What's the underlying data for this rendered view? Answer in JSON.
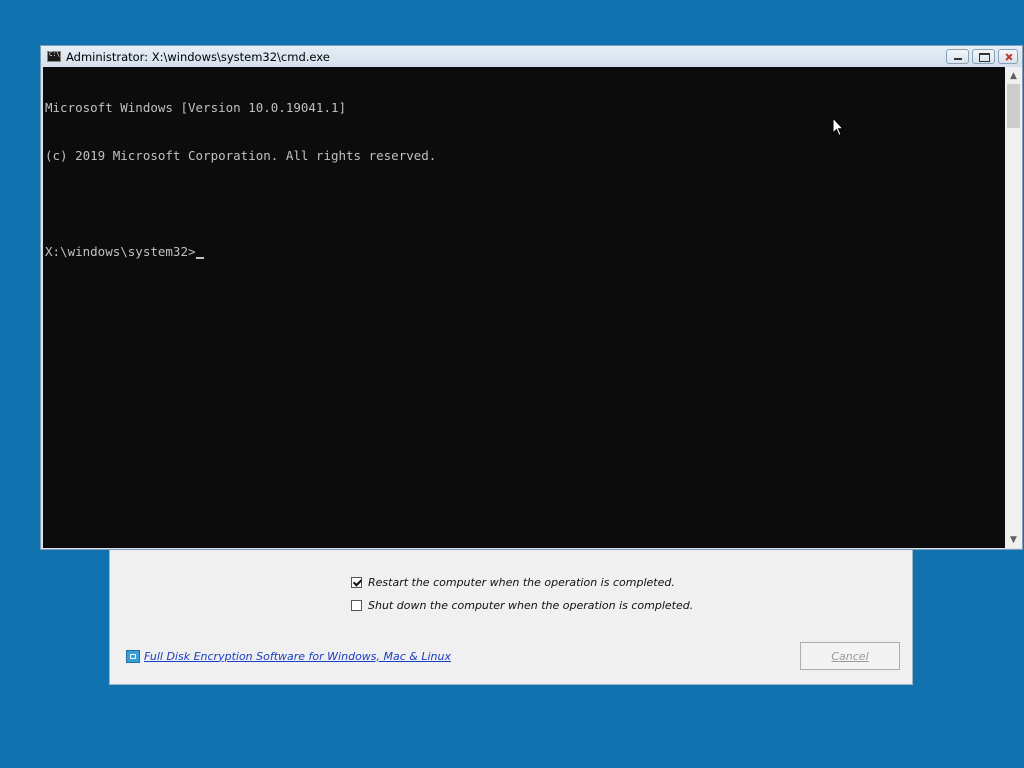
{
  "dialog": {
    "options": [
      {
        "label": "Restart the computer when the operation is completed.",
        "checked": true
      },
      {
        "label": "Shut down the computer when the operation is completed.",
        "checked": false
      }
    ],
    "link_text": "Full Disk Encryption Software for Windows, Mac & Linux",
    "cancel_label": "Cancel"
  },
  "cmd": {
    "title": "Administrator: X:\\windows\\system32\\cmd.exe",
    "lines": [
      "Microsoft Windows [Version 10.0.19041.1]",
      "(c) 2019 Microsoft Corporation. All rights reserved.",
      "",
      "X:\\windows\\system32>"
    ]
  },
  "colors": {
    "desktop": "#1172b0",
    "console_bg": "#0c0c0c",
    "console_text": "#c0c0c0",
    "link": "#1a3ec4"
  }
}
